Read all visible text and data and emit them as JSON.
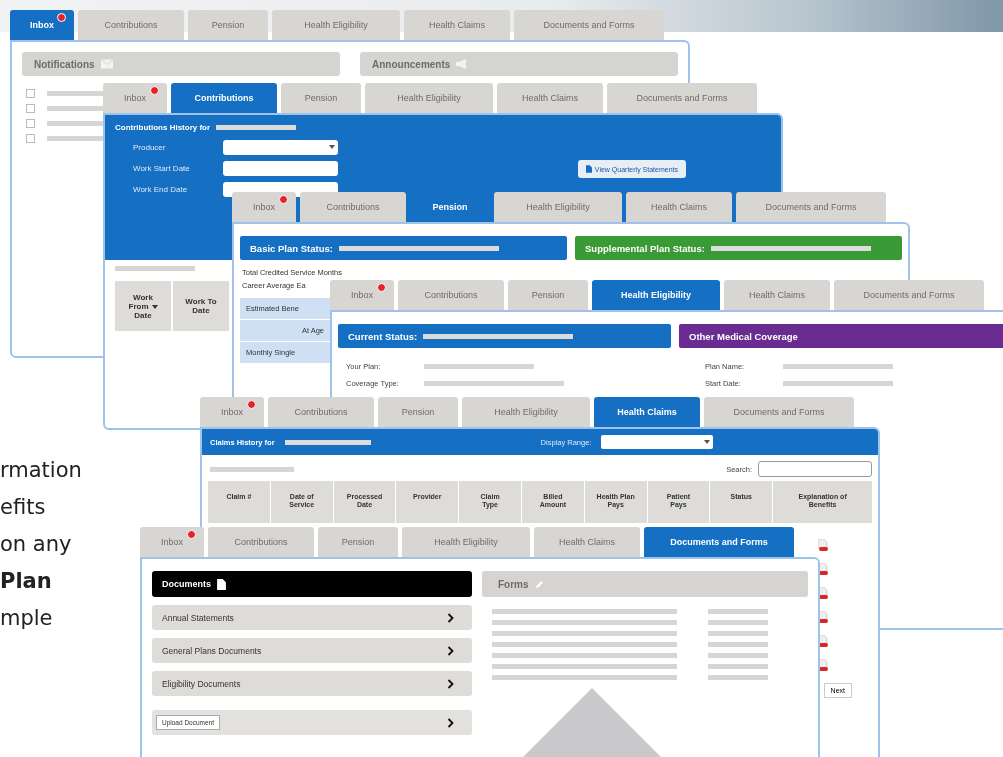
{
  "intro_lines": [
    {
      "text": "rmation",
      "bold": false
    },
    {
      "text": "efits",
      "bold": false
    },
    {
      "text": "on any",
      "bold": false
    },
    {
      "text": "Plan",
      "bold": true
    },
    {
      "text": "mple",
      "bold": false
    }
  ],
  "panels": [
    {
      "kind": "inbox",
      "tabs": [
        {
          "label": "Inbox",
          "badge": true,
          "selected": true
        },
        {
          "label": "Contributions",
          "badge": false,
          "selected": false
        },
        {
          "label": "Pension",
          "badge": false,
          "selected": false
        },
        {
          "label": "Health Eligibility",
          "badge": false,
          "selected": false
        },
        {
          "label": "Health Claims",
          "badge": false,
          "selected": false
        },
        {
          "label": "Documents and Forms",
          "badge": false,
          "selected": false
        }
      ],
      "sections": [
        "Notifications",
        "Announcements"
      ],
      "rows": [
        {
          "checked": false
        },
        {
          "checked": false
        },
        {
          "checked": false
        },
        {
          "checked": false
        }
      ]
    },
    {
      "kind": "contributions",
      "tabs": [
        {
          "label": "Inbox",
          "badge": true,
          "selected": false
        },
        {
          "label": "Contributions",
          "badge": false,
          "selected": true
        },
        {
          "label": "Pension",
          "badge": false,
          "selected": false
        },
        {
          "label": "Health Eligibility",
          "badge": false,
          "selected": false
        },
        {
          "label": "Health Claims",
          "badge": false,
          "selected": false
        },
        {
          "label": "Documents and Forms",
          "badge": false,
          "selected": false
        }
      ],
      "title": "Contributions History for",
      "fields": [
        {
          "label": "Producer",
          "kind": "select"
        },
        {
          "label": "Work Start Date",
          "kind": "text"
        },
        {
          "label": "Work End Date",
          "kind": "text"
        }
      ],
      "button": "View Quarterly Statements",
      "columns": [
        {
          "lines": [
            "Work",
            "From",
            "Date"
          ],
          "sort": true
        },
        {
          "lines": [
            "Work To",
            "Date"
          ],
          "sort": false
        }
      ]
    },
    {
      "kind": "pension",
      "tabs": [
        {
          "label": "Inbox",
          "badge": true,
          "selected": false
        },
        {
          "label": "Contributions",
          "badge": false,
          "selected": false
        },
        {
          "label": "Pension",
          "badge": false,
          "selected": true
        },
        {
          "label": "Health Eligibility",
          "badge": false,
          "selected": false
        },
        {
          "label": "Health Claims",
          "badge": false,
          "selected": false
        },
        {
          "label": "Documents and Forms",
          "badge": false,
          "selected": false
        }
      ],
      "bars": [
        {
          "label": "Basic Plan Status:",
          "color": "#1570c4"
        },
        {
          "label": "Supplemental Plan Status:",
          "color": "#3a9a35"
        }
      ],
      "lines": [
        "Total Credited Service Months",
        "Career Average Ea"
      ],
      "cells": [
        "Estimated Bene",
        "At Age",
        "Monthly Single"
      ]
    },
    {
      "kind": "eligibility",
      "tabs": [
        {
          "label": "Inbox",
          "badge": true,
          "selected": false
        },
        {
          "label": "Contributions",
          "badge": false,
          "selected": false
        },
        {
          "label": "Pension",
          "badge": false,
          "selected": false
        },
        {
          "label": "Health Eligibility",
          "badge": false,
          "selected": true
        },
        {
          "label": "Health Claims",
          "badge": false,
          "selected": false
        },
        {
          "label": "Documents and Forms",
          "badge": false,
          "selected": false
        }
      ],
      "bars": [
        {
          "label": "Current Status:",
          "color": "#1570c4"
        },
        {
          "label": "Other Medical Coverage",
          "color": "#6a2c91"
        }
      ],
      "left_fields": [
        "Your Plan:",
        "Coverage Type:"
      ],
      "right_fields": [
        "Plan Name:",
        "Start Date:"
      ]
    },
    {
      "kind": "claims",
      "tabs": [
        {
          "label": "Inbox",
          "badge": true,
          "selected": false
        },
        {
          "label": "Contributions",
          "badge": false,
          "selected": false
        },
        {
          "label": "Pension",
          "badge": false,
          "selected": false
        },
        {
          "label": "Health Eligibility",
          "badge": false,
          "selected": false
        },
        {
          "label": "Health Claims",
          "badge": false,
          "selected": true
        },
        {
          "label": "Documents and Forms",
          "badge": false,
          "selected": false
        }
      ],
      "title": "Claims History for",
      "range_label": "Display Range:",
      "search_label": "Search:",
      "columns": [
        [
          "Claim #"
        ],
        [
          "Date of",
          "Service"
        ],
        [
          "Processed",
          "Date"
        ],
        [
          "Provider"
        ],
        [
          "Claim",
          "Type"
        ],
        [
          "Billed",
          "Amount"
        ],
        [
          "Health Plan",
          "Pays"
        ],
        [
          "Patient",
          "Pays"
        ],
        [
          "Status"
        ],
        [
          "Explanation of",
          "Benefits"
        ]
      ],
      "next": "Next"
    },
    {
      "kind": "documents",
      "tabs": [
        {
          "label": "Inbox",
          "badge": true,
          "selected": false
        },
        {
          "label": "Contributions",
          "badge": false,
          "selected": false
        },
        {
          "label": "Pension",
          "badge": false,
          "selected": false
        },
        {
          "label": "Health Eligibility",
          "badge": false,
          "selected": false
        },
        {
          "label": "Health Claims",
          "badge": false,
          "selected": false
        },
        {
          "label": "Documents and Forms",
          "badge": false,
          "selected": true
        }
      ],
      "documents_title": "Documents",
      "forms_title": "Forms",
      "items": [
        "Annual Statements",
        "General Plans Documents",
        "Eligibility Documents"
      ],
      "upload": "Upload Document"
    }
  ]
}
